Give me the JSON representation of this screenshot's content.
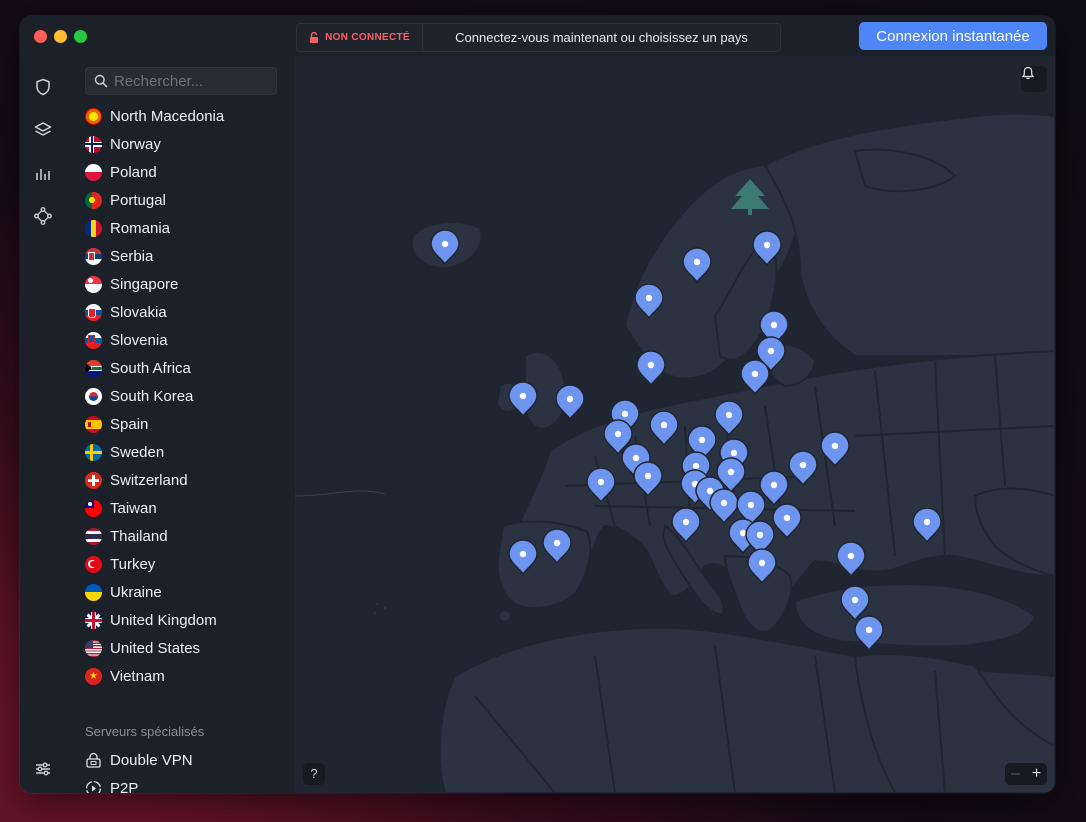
{
  "status": {
    "label": "NON CONNECTÉ",
    "message": "Connectez-vous maintenant ou choisissez un pays"
  },
  "toolbar": {
    "connect_label": "Connexion instantanée"
  },
  "search": {
    "placeholder": "Rechercher..."
  },
  "countries": [
    {
      "name": "North Macedonia",
      "flag": "north-macedonia"
    },
    {
      "name": "Norway",
      "flag": "norway"
    },
    {
      "name": "Poland",
      "flag": "poland"
    },
    {
      "name": "Portugal",
      "flag": "portugal"
    },
    {
      "name": "Romania",
      "flag": "romania"
    },
    {
      "name": "Serbia",
      "flag": "serbia"
    },
    {
      "name": "Singapore",
      "flag": "singapore"
    },
    {
      "name": "Slovakia",
      "flag": "slovakia"
    },
    {
      "name": "Slovenia",
      "flag": "slovenia"
    },
    {
      "name": "South Africa",
      "flag": "south-africa"
    },
    {
      "name": "South Korea",
      "flag": "south-korea"
    },
    {
      "name": "Spain",
      "flag": "spain"
    },
    {
      "name": "Sweden",
      "flag": "sweden"
    },
    {
      "name": "Switzerland",
      "flag": "switzerland"
    },
    {
      "name": "Taiwan",
      "flag": "taiwan"
    },
    {
      "name": "Thailand",
      "flag": "thailand"
    },
    {
      "name": "Turkey",
      "flag": "turkey"
    },
    {
      "name": "Ukraine",
      "flag": "ukraine"
    },
    {
      "name": "United Kingdom",
      "flag": "united-kingdom"
    },
    {
      "name": "United States",
      "flag": "united-states"
    },
    {
      "name": "Vietnam",
      "flag": "vietnam"
    }
  ],
  "specialty": {
    "title": "Serveurs spécialisés",
    "items": [
      {
        "name": "Double VPN",
        "icon": "double-vpn-icon"
      },
      {
        "name": "P2P",
        "icon": "p2p-icon"
      }
    ]
  },
  "map": {
    "help_label": "?",
    "zoom_out_label": "–",
    "zoom_in_label": "+"
  },
  "colors": {
    "accent": "#4f86f7",
    "status_disconnected": "#ff5c66",
    "pin": "#6d95ef",
    "map_sea": "#1f2531",
    "map_land": "#2c3342"
  }
}
